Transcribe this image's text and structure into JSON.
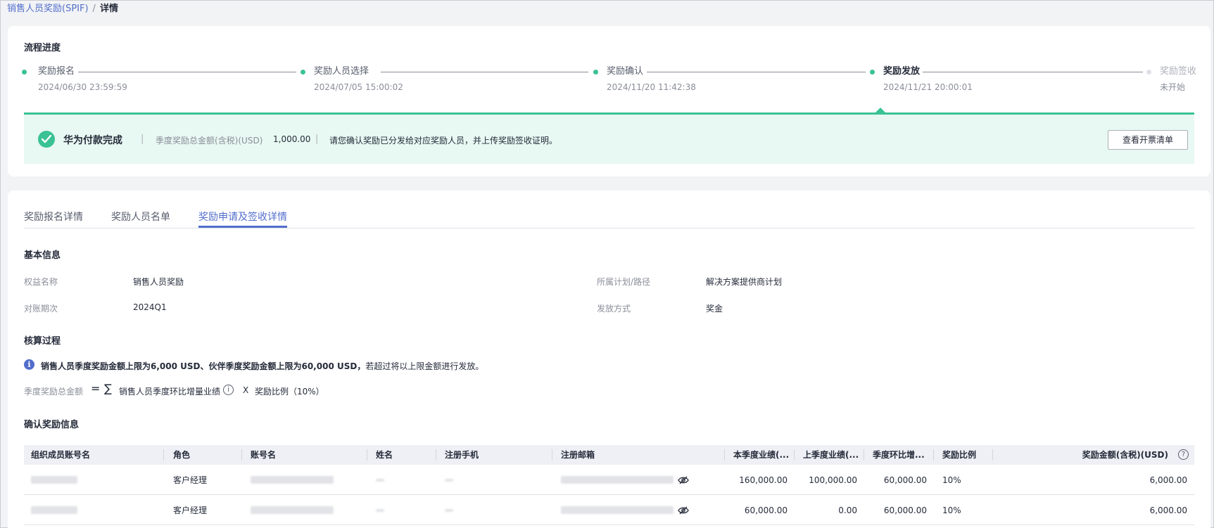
{
  "breadcrumb": {
    "parent": "销售人员奖励(SPIF)",
    "separator": "/",
    "current": "详情"
  },
  "progress": {
    "title": "流程进度",
    "steps": [
      {
        "label": "奖励报名",
        "time": "2024/06/30 23:59:59",
        "state": "done"
      },
      {
        "label": "奖励人员选择",
        "time": "2024/07/05 15:00:02",
        "state": "done"
      },
      {
        "label": "奖励确认",
        "time": "2024/11/20 11:42:38",
        "state": "done"
      },
      {
        "label": "奖励发放",
        "time": "2024/11/21 20:00:01",
        "state": "active"
      },
      {
        "label": "奖励签收",
        "time": "未开始",
        "state": "pending"
      }
    ],
    "notice": {
      "status": "华为付款完成",
      "amount_label": "季度奖励总金额(含税)(USD)",
      "amount_value": "1,000.00",
      "message": "请您确认奖励已分发给对应奖励人员，并上传奖励签收证明。",
      "button": "查看开票清单"
    }
  },
  "tabs": [
    {
      "label": "奖励报名详情",
      "active": false
    },
    {
      "label": "奖励人员名单",
      "active": false
    },
    {
      "label": "奖励申请及签收详情",
      "active": true
    }
  ],
  "basic_info": {
    "title": "基本信息",
    "fields": [
      {
        "label": "权益名称",
        "value": "销售人员奖励"
      },
      {
        "label": "所属计划/路径",
        "value": "解决方案提供商计划"
      },
      {
        "label": "对账期次",
        "value": "2024Q1"
      },
      {
        "label": "发放方式",
        "value": "奖金"
      }
    ]
  },
  "calculation": {
    "title": "核算过程",
    "info_bold": "销售人员季度奖励金额上限为6,000 USD、伙伴季度奖励金额上限为60,000 USD，",
    "info_rest": "若超过将以上限金额进行发放。",
    "formula_label": "季度奖励总金额",
    "equals": "=",
    "sigma": "∑",
    "term1": "销售人员季度环比增量业绩",
    "times": "X",
    "term2": "奖励比例（10%）"
  },
  "confirm": {
    "title": "确认奖励信息",
    "columns": [
      "组织成员账号名",
      "角色",
      "账号名",
      "姓名",
      "注册手机",
      "注册邮箱",
      "本季度业绩(...",
      "上季度业绩(...",
      "季度环比增...",
      "奖励比例",
      "奖励金额(含税)(USD)"
    ],
    "rows": [
      {
        "role": "客户经理",
        "current": "160,000.00",
        "previous": "100,000.00",
        "increase": "60,000.00",
        "ratio": "10%",
        "amount": "6,000.00"
      },
      {
        "role": "客户经理",
        "current": "60,000.00",
        "previous": "0.00",
        "increase": "60,000.00",
        "ratio": "10%",
        "amount": "6,000.00"
      }
    ]
  },
  "colors": {
    "accent": "#526ecc",
    "success": "#3ac295",
    "notice_bg": "#e8f8f2"
  },
  "icons": [
    "check-circle-icon",
    "info-icon",
    "help-circle-icon",
    "eye-off-icon"
  ]
}
